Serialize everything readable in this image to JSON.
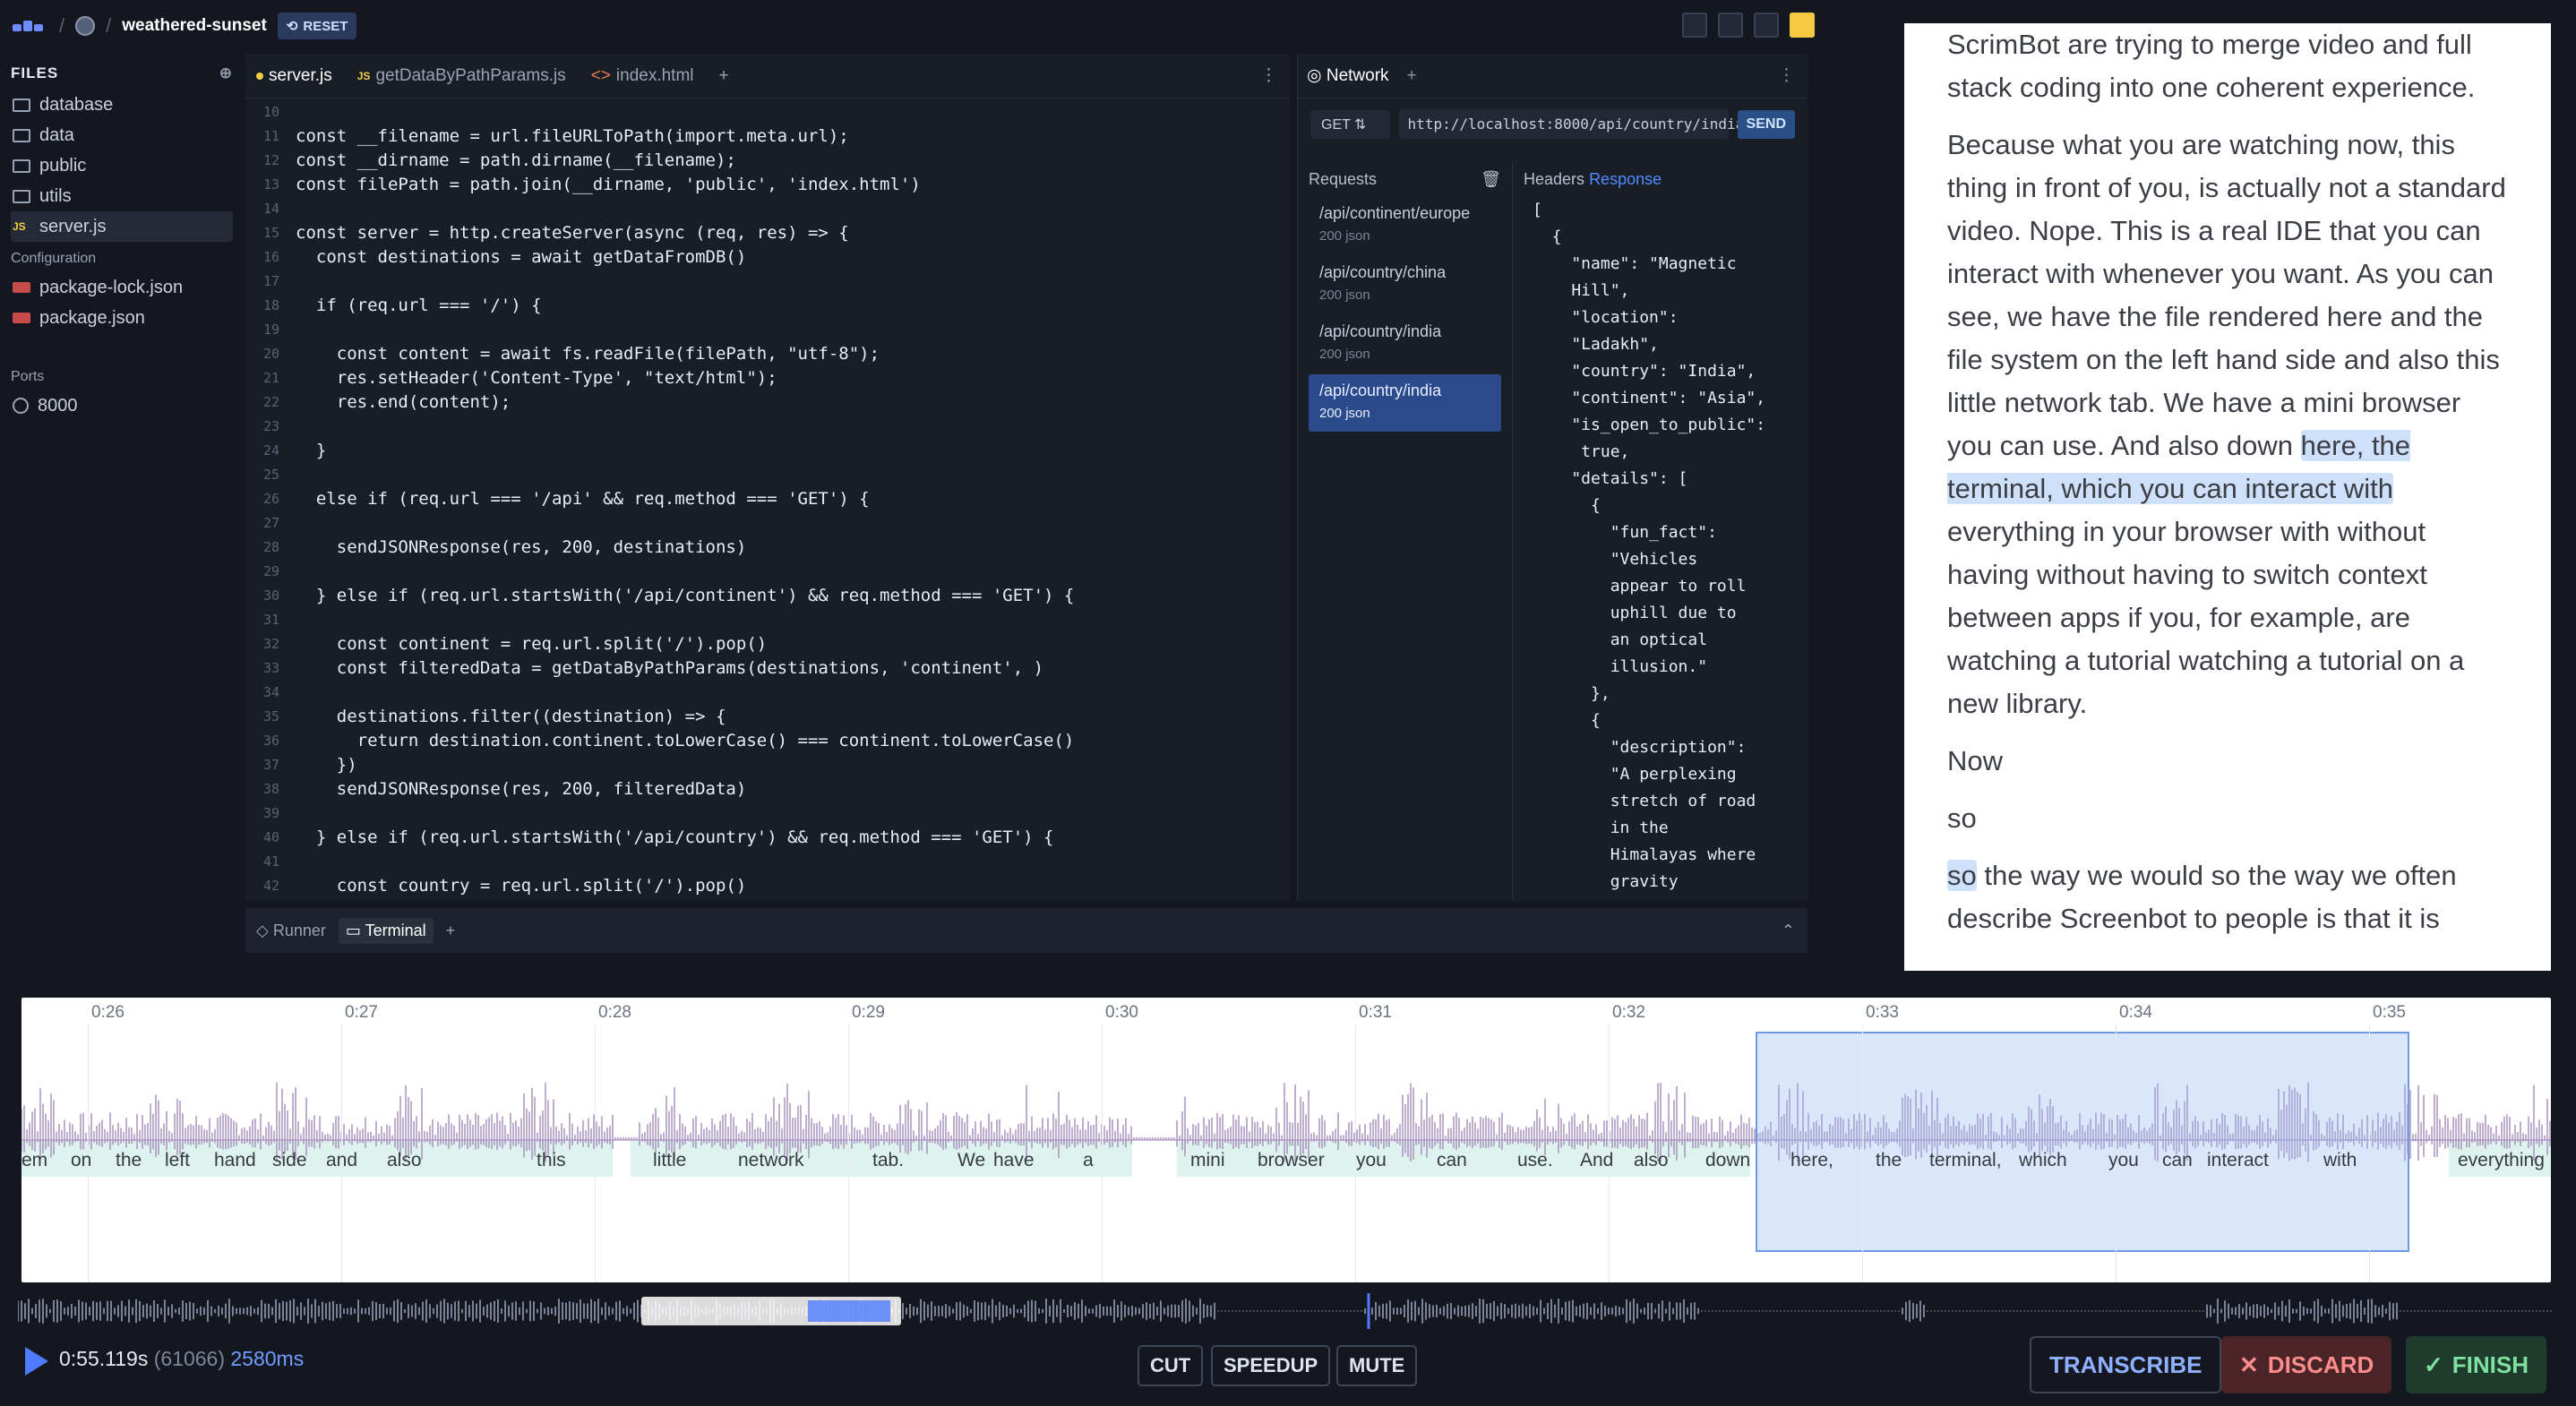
{
  "topbar": {
    "project": "weathered-sunset",
    "reset_label": "RESET"
  },
  "sidebar": {
    "files_heading": "FILES",
    "items": [
      "database",
      "data",
      "public",
      "utils",
      "server.js"
    ],
    "config_heading": "Configuration",
    "config_items": [
      "package-lock.json",
      "package.json"
    ],
    "ports_heading": "Ports",
    "port": "8000"
  },
  "editor": {
    "tabs": [
      "server.js",
      "getDataByPathParams.js",
      "index.html"
    ],
    "lines": [
      {
        "n": "10",
        "t": ""
      },
      {
        "n": "11",
        "t": "const __filename = url.fileURLToPath(import.meta.url);"
      },
      {
        "n": "12",
        "t": "const __dirname = path.dirname(__filename);"
      },
      {
        "n": "13",
        "t": "const filePath = path.join(__dirname, 'public', 'index.html')"
      },
      {
        "n": "14",
        "t": ""
      },
      {
        "n": "15",
        "t": "const server = http.createServer(async (req, res) => {"
      },
      {
        "n": "16",
        "t": "  const destinations = await getDataFromDB()"
      },
      {
        "n": "17",
        "t": ""
      },
      {
        "n": "18",
        "t": "  if (req.url === '/') {"
      },
      {
        "n": "19",
        "t": ""
      },
      {
        "n": "20",
        "t": "    const content = await fs.readFile(filePath, \"utf-8\");"
      },
      {
        "n": "21",
        "t": "    res.setHeader('Content-Type', \"text/html\");"
      },
      {
        "n": "22",
        "t": "    res.end(content);"
      },
      {
        "n": "23",
        "t": ""
      },
      {
        "n": "24",
        "t": "  }"
      },
      {
        "n": "25",
        "t": ""
      },
      {
        "n": "26",
        "t": "  else if (req.url === '/api' && req.method === 'GET') {"
      },
      {
        "n": "27",
        "t": ""
      },
      {
        "n": "28",
        "t": "    sendJSONResponse(res, 200, destinations)"
      },
      {
        "n": "29",
        "t": ""
      },
      {
        "n": "30",
        "t": "  } else if (req.url.startsWith('/api/continent') && req.method === 'GET') {"
      },
      {
        "n": "31",
        "t": ""
      },
      {
        "n": "32",
        "t": "    const continent = req.url.split('/').pop()"
      },
      {
        "n": "33",
        "t": "    const filteredData = getDataByPathParams(destinations, 'continent', )"
      },
      {
        "n": "34",
        "t": ""
      },
      {
        "n": "35",
        "t": "    destinations.filter((destination) => {"
      },
      {
        "n": "36",
        "t": "      return destination.continent.toLowerCase() === continent.toLowerCase()"
      },
      {
        "n": "37",
        "t": "    })"
      },
      {
        "n": "38",
        "t": "    sendJSONResponse(res, 200, filteredData)"
      },
      {
        "n": "39",
        "t": ""
      },
      {
        "n": "40",
        "t": "  } else if (req.url.startsWith('/api/country') && req.method === 'GET') {"
      },
      {
        "n": "41",
        "t": ""
      },
      {
        "n": "42",
        "t": "    const country = req.url.split('/').pop()"
      }
    ]
  },
  "network": {
    "tab": "Network",
    "method": "GET",
    "url": "http://localhost:8000/api/country/india",
    "send": "SEND",
    "requests_heading": "Requests",
    "headers_label": "Headers",
    "response_label": "Response",
    "requests": [
      {
        "path": "/api/continent/europe",
        "status": "200 json"
      },
      {
        "path": "/api/country/china",
        "status": "200 json"
      },
      {
        "path": "/api/country/india",
        "status": "200 json"
      },
      {
        "path": "/api/country/india",
        "status": "200 json"
      }
    ],
    "json_lines": [
      "[",
      "  {",
      "    \"name\": \"Magnetic",
      "    Hill\",",
      "    \"location\":",
      "    \"Ladakh\",",
      "    \"country\": \"India\",",
      "    \"continent\": \"Asia\",",
      "    \"is_open_to_public\":",
      "     true,",
      "    \"details\": [",
      "      {",
      "        \"fun_fact\":",
      "        \"Vehicles",
      "        appear to roll",
      "        uphill due to",
      "        an optical",
      "        illusion.\"",
      "      },",
      "      {",
      "        \"description\":",
      "        \"A perplexing",
      "        stretch of road",
      "        in the",
      "        Himalayas where",
      "        gravity"
    ]
  },
  "terminal": {
    "runner": "Runner",
    "terminal": "Terminal"
  },
  "transcript": {
    "p1": "ScrimBot are trying to merge video and full stack coding into one coherent experience.",
    "p2a": "Because what you are watching now, this thing in front of you, is actually not a standard video. Nope. This is a real IDE that you can interact with whenever you want. As you can see, we have the file rendered here and the file system on the left hand side and also this little network tab. We have a mini browser you can use. And also down ",
    "p2b": "here, the terminal, which you can interact with",
    "p2c": " everything in your browser with without having without having to switch context between apps if you, for example, are watching a tutorial watching a tutorial on a new library.",
    "p3": "Now",
    "p4": "so",
    "p5a": "so",
    "p5b": " the way we would so the way we often describe Screenbot to people is that it is"
  },
  "timeline": {
    "ticks": [
      "0:26",
      "0:27",
      "0:28",
      "0:29",
      "0:30",
      "0:31",
      "0:32",
      "0:33",
      "0:34",
      "0:35"
    ],
    "words": [
      "em",
      "on",
      "the",
      "left",
      "hand",
      "side",
      "and",
      "also",
      "this",
      "little",
      "network",
      "tab.",
      "We",
      "have",
      "a",
      "mini",
      "browser",
      "you",
      "can",
      "use.",
      "And",
      "also",
      "down",
      "here,",
      "the",
      "terminal,",
      "which",
      "you",
      "can",
      "interact",
      "with",
      "everything"
    ]
  },
  "controls": {
    "time": "0:55.119s",
    "frames": "(61066)",
    "duration": "2580ms",
    "cut": "CUT",
    "speedup": "SPEEDUP",
    "mute": "MUTE",
    "transcribe": "TRANSCRIBE",
    "discard": "DISCARD",
    "finish": "FINISH"
  },
  "colors": {
    "accent": "#4f7cff",
    "finish": "#1f3b2c",
    "discard": "#4a2426"
  }
}
